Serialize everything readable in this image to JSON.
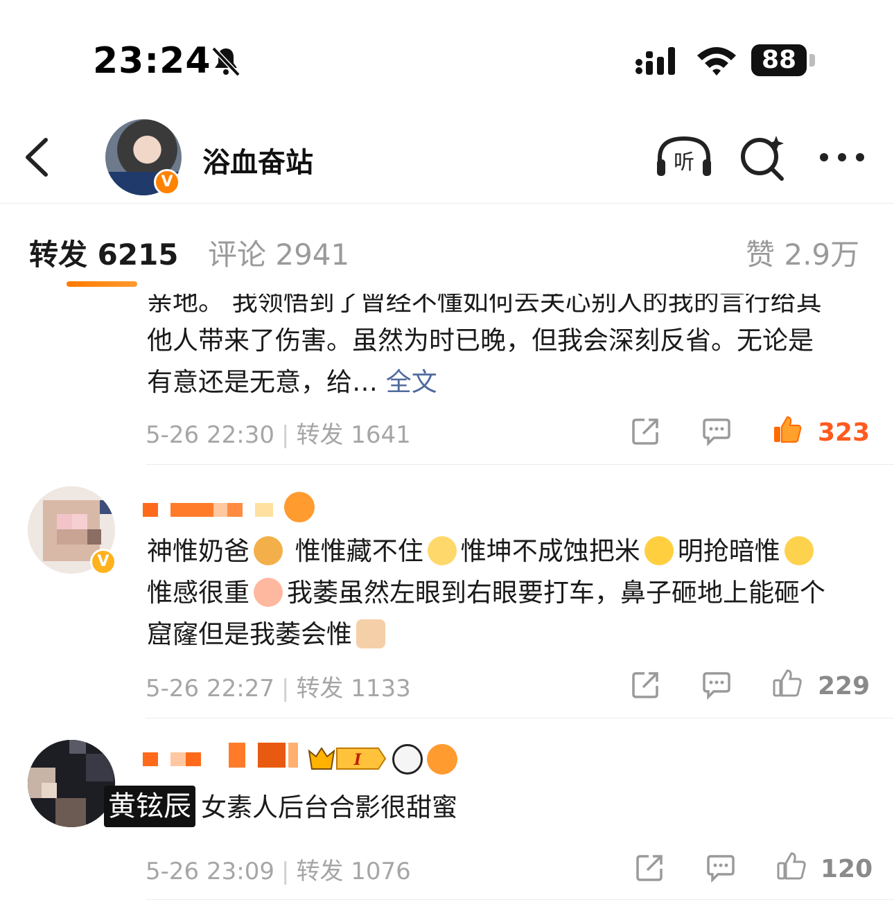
{
  "status_bar": {
    "time": "23:24",
    "battery": "88"
  },
  "header": {
    "title": "浴血奋站"
  },
  "tabs": {
    "repost": "转发 6215",
    "comment": "评论 2941",
    "like": "赞 2.9万"
  },
  "posts": [
    {
      "cut_line": "亲地。 我领悟到了曾经不懂如何去关心别人的我的言行给其",
      "text_lines": [
        "他人带来了伤害。虽然为时已晚，但我会深刻反省。无论是",
        "有意还是无意，给… "
      ],
      "full_text_link": "全文",
      "time": "5-26 22:30",
      "repost_label": "转发 1641",
      "likes": "323"
    },
    {
      "text_1": "神惟奶爸",
      "text_2": "惟惟藏不住",
      "text_3": "惟坤不成蚀把米",
      "text_4": "明抢暗惟",
      "text_5": "惟感很重",
      "text_6": "我萎虽然左眼到右眼要打车，鼻子砸地上能砸个",
      "text_7": "窟窿但是我萎会惟",
      "time": "5-26 22:27",
      "repost_label": "转发 1133",
      "likes": "229"
    },
    {
      "name_overlay": "黄铉辰",
      "text": "女素人后台合影很甜蜜",
      "time": "5-26 23:09",
      "repost_label": "转发 1076",
      "likes": "120"
    }
  ],
  "icons": [
    "bell-muted-icon",
    "signal-icon",
    "wifi-icon",
    "back-icon",
    "listen-icon",
    "ai-search-icon",
    "more-icon",
    "share-icon",
    "comment-icon",
    "like-icon"
  ],
  "colors": {
    "accent": "#ff8200",
    "like_active": "#ff5a1f",
    "link": "#506a9e",
    "muted": "#a6a6a6"
  }
}
